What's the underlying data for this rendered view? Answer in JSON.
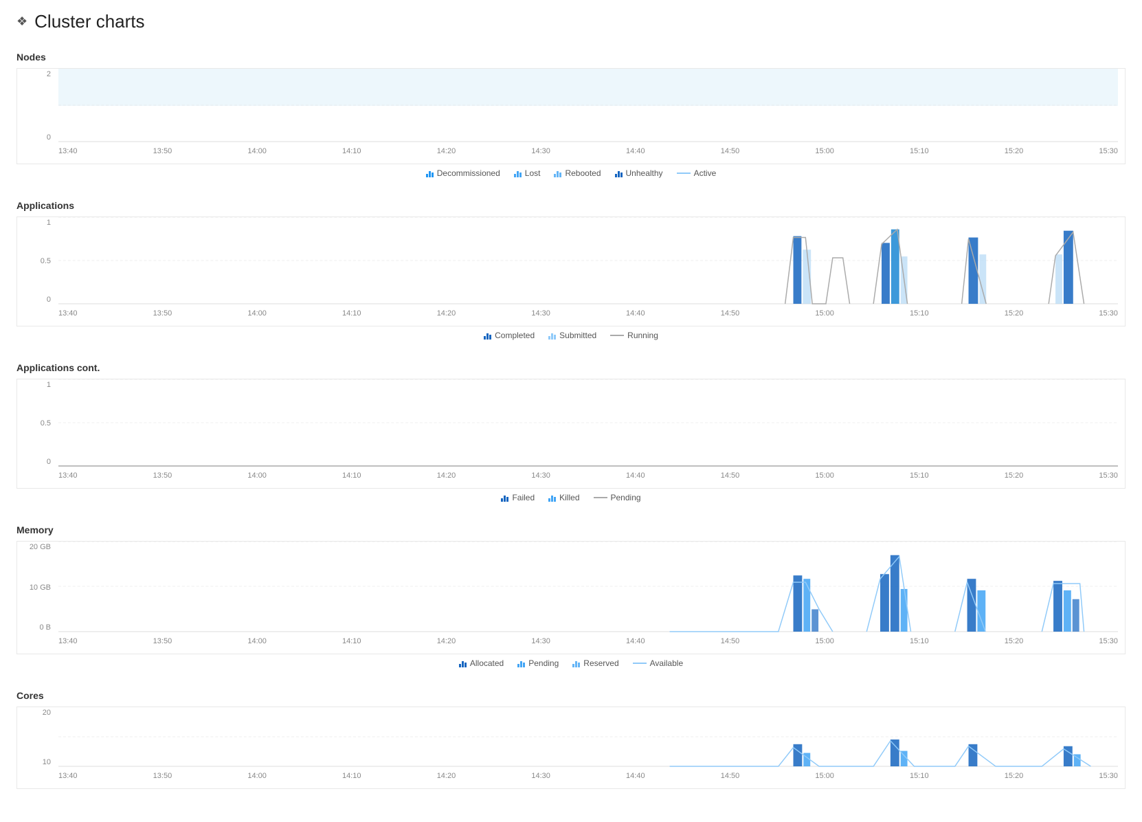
{
  "header": {
    "icon": "❖",
    "title": "Cluster charts"
  },
  "charts": {
    "nodes": {
      "title": "Nodes",
      "yLabels": [
        "2",
        "0"
      ],
      "xLabels": [
        "13:40",
        "13:50",
        "14:00",
        "14:10",
        "14:20",
        "14:30",
        "14:40",
        "14:50",
        "15:00",
        "15:10",
        "15:20",
        "15:30"
      ],
      "legend": [
        {
          "type": "bar",
          "color": "#2196F3",
          "label": "Decommissioned"
        },
        {
          "type": "bar",
          "color": "#42A5F5",
          "label": "Lost"
        },
        {
          "type": "bar",
          "color": "#64B5F6",
          "label": "Rebooted"
        },
        {
          "type": "bar",
          "color": "#1565C0",
          "label": "Unhealthy"
        },
        {
          "type": "line",
          "color": "#90CAF9",
          "label": "Active"
        }
      ]
    },
    "applications": {
      "title": "Applications",
      "yLabels": [
        "1",
        "0.5",
        "0"
      ],
      "xLabels": [
        "13:40",
        "13:50",
        "14:00",
        "14:10",
        "14:20",
        "14:30",
        "14:40",
        "14:50",
        "15:00",
        "15:10",
        "15:20",
        "15:30"
      ],
      "legend": [
        {
          "type": "bar",
          "color": "#1565C0",
          "label": "Completed"
        },
        {
          "type": "bar",
          "color": "#90CAF9",
          "label": "Submitted"
        },
        {
          "type": "line",
          "color": "#aaa",
          "label": "Running"
        }
      ]
    },
    "applications_cont": {
      "title": "Applications cont.",
      "yLabels": [
        "1",
        "0.5",
        "0"
      ],
      "xLabels": [
        "13:40",
        "13:50",
        "14:00",
        "14:10",
        "14:20",
        "14:30",
        "14:40",
        "14:50",
        "15:00",
        "15:10",
        "15:20",
        "15:30"
      ],
      "legend": [
        {
          "type": "bar",
          "color": "#1565C0",
          "label": "Failed"
        },
        {
          "type": "bar",
          "color": "#42A5F5",
          "label": "Killed"
        },
        {
          "type": "line",
          "color": "#aaa",
          "label": "Pending"
        }
      ]
    },
    "memory": {
      "title": "Memory",
      "yLabels": [
        "20 GB",
        "10 GB",
        "0 B"
      ],
      "xLabels": [
        "13:40",
        "13:50",
        "14:00",
        "14:10",
        "14:20",
        "14:30",
        "14:40",
        "14:50",
        "15:00",
        "15:10",
        "15:20",
        "15:30"
      ],
      "legend": [
        {
          "type": "bar",
          "color": "#1565C0",
          "label": "Allocated"
        },
        {
          "type": "bar",
          "color": "#42A5F5",
          "label": "Pending"
        },
        {
          "type": "bar",
          "color": "#64B5F6",
          "label": "Reserved"
        },
        {
          "type": "line",
          "color": "#90CAF9",
          "label": "Available"
        }
      ]
    },
    "cores": {
      "title": "Cores",
      "yLabels": [
        "20",
        "10"
      ],
      "xLabels": [
        "13:40",
        "13:50",
        "14:00",
        "14:10",
        "14:20",
        "14:30",
        "14:40",
        "14:50",
        "15:00",
        "15:10",
        "15:20",
        "15:30"
      ]
    }
  }
}
